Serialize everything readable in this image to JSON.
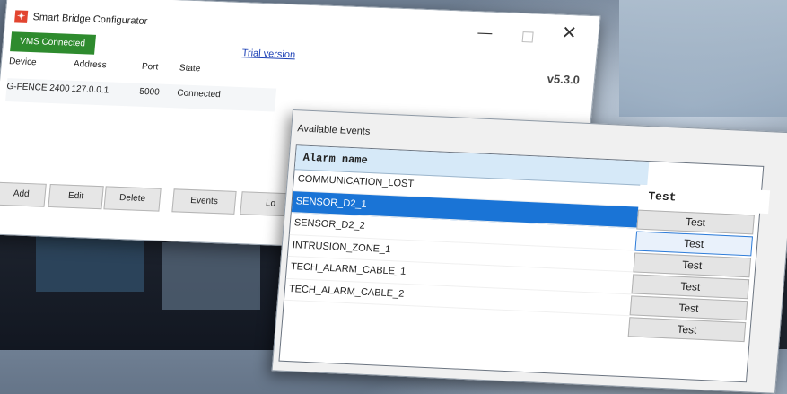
{
  "app": {
    "title": "Smart Bridge Configurator",
    "vms_status": "VMS Connected",
    "trial_link": "Trial version",
    "version": "v5.3.0"
  },
  "device_table": {
    "headers": [
      "Device",
      "Address",
      "Port",
      "State"
    ],
    "rows": [
      [
        "G-FENCE 2400",
        "127.0.0.1",
        "5000",
        "Connected"
      ]
    ]
  },
  "buttons": {
    "add": "Add",
    "edit": "Edit",
    "delete": "Delete",
    "events": "Events",
    "log": "Lo"
  },
  "events_panel": {
    "title": "Available Events",
    "column_header": "Alarm name",
    "test_header": "Test",
    "alarms": [
      "COMMUNICATION_LOST",
      "SENSOR_D2_1",
      "SENSOR_D2_2",
      "INTRUSION_ZONE_1",
      "TECH_ALARM_CABLE_1",
      "TECH_ALARM_CABLE_2"
    ],
    "selected_index": 1,
    "test_button_label": "Test"
  },
  "colors": {
    "vms_green": "#2e8b2e",
    "selection_blue": "#1a74d6",
    "header_blue": "#d6e9f8"
  },
  "icons": {
    "app": "bridge-app-icon",
    "close": "close-icon",
    "minimize": "minimize-icon",
    "maximize": "maximize-icon"
  }
}
